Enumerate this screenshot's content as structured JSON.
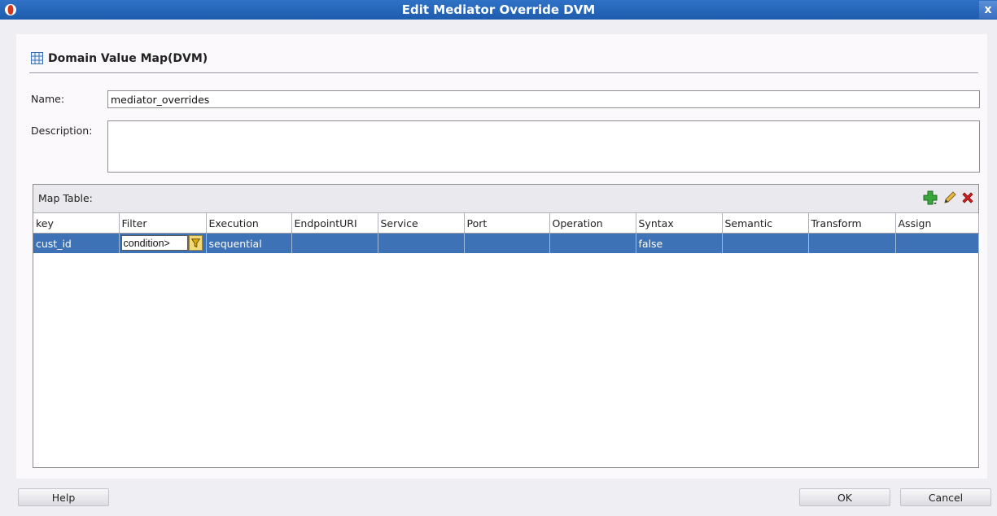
{
  "window": {
    "title": "Edit Mediator Override DVM",
    "close_glyph": "x"
  },
  "heading": "Domain Value Map(DVM)",
  "name": {
    "label": "Name:",
    "value": "mediator_overrides"
  },
  "description": {
    "label": "Description:",
    "value": ""
  },
  "map_table": {
    "label": "Map Table:",
    "toolbar": [
      "add-icon",
      "edit-icon",
      "delete-icon"
    ],
    "columns": [
      "key",
      "Filter",
      "Execution",
      "EndpointURI",
      "Service",
      "Port",
      "Operation",
      "Syntax",
      "Semantic",
      "Transform",
      "Assign"
    ],
    "rows": [
      {
        "key": "cust_id",
        "filter": "condition>",
        "execution": "sequential",
        "endpoint": "",
        "service": "",
        "port": "",
        "operation": "",
        "syntax": "false",
        "semantic": "",
        "transform": "",
        "assign": ""
      }
    ]
  },
  "buttons": {
    "help": "Help",
    "ok": "OK",
    "cancel": "Cancel"
  },
  "colors": {
    "titlebar": "#1e5cad",
    "selection": "#3e72b6",
    "add": "#3aa53a",
    "delete": "#d42020"
  }
}
